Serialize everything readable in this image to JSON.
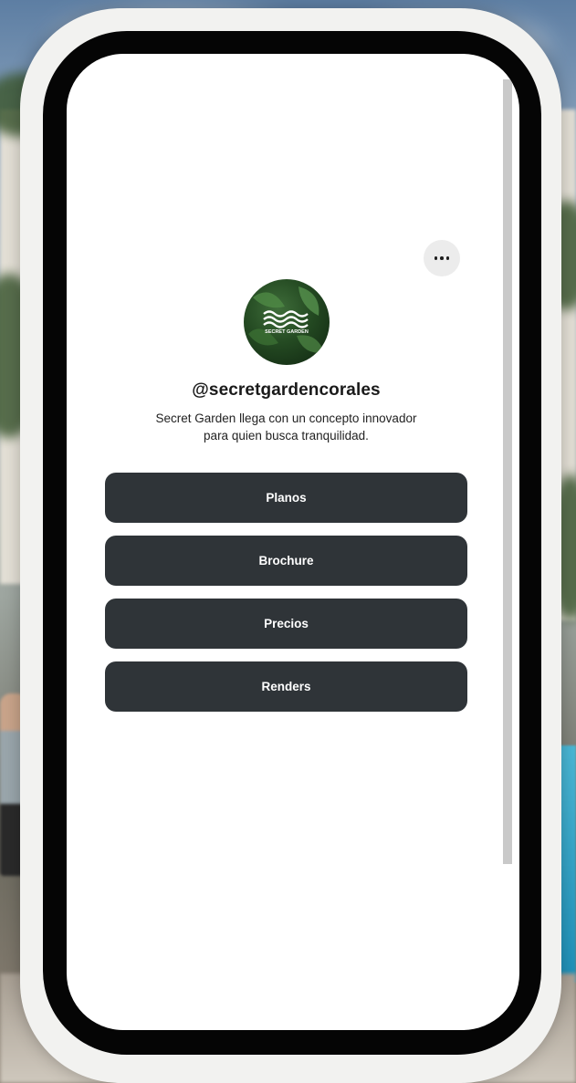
{
  "profile": {
    "username": "@secretgardencorales",
    "bio_line1": "Secret Garden llega con un concepto innovador",
    "bio_line2": "para quien busca tranquilidad.",
    "avatar_logo_text": "SECRET GARDEN"
  },
  "menu": {
    "icon": "more-horizontal-icon"
  },
  "links": [
    {
      "label": "Planos"
    },
    {
      "label": "Brochure"
    },
    {
      "label": "Precios"
    },
    {
      "label": "Renders"
    }
  ],
  "colors": {
    "button_bg": "#2f3438",
    "button_text": "#ffffff",
    "screen_bg": "#ffffff",
    "phone_frame": "#050505"
  }
}
